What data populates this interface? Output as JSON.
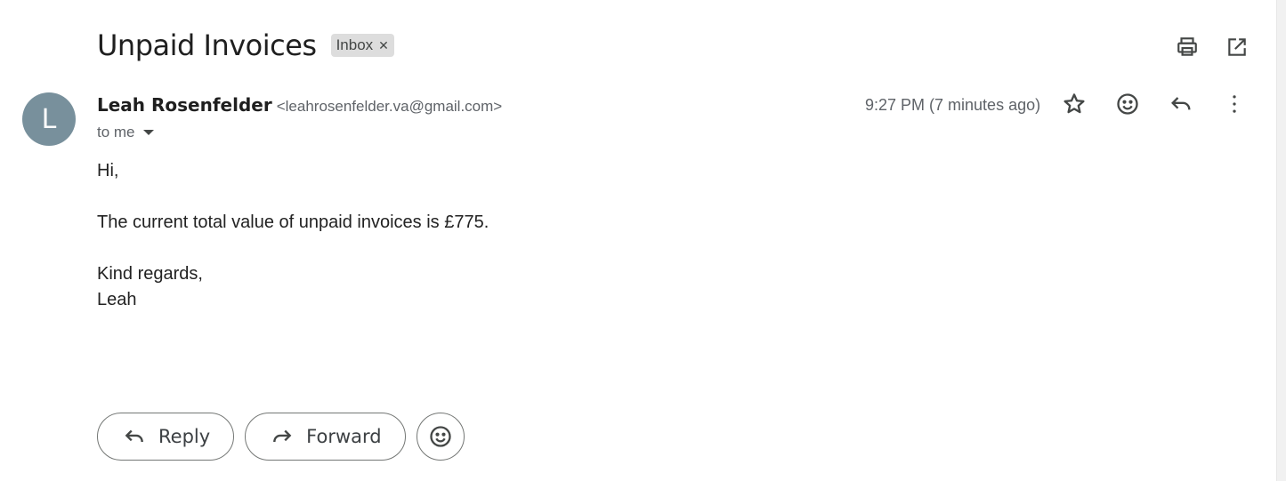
{
  "email": {
    "subject": "Unpaid Invoices",
    "label": "Inbox",
    "sender_name": "Leah Rosenfelder",
    "sender_email": "<leahrosenfelder.va@gmail.com>",
    "avatar_letter": "L",
    "recipient": "to me",
    "time": "9:27 PM (7 minutes ago)",
    "body": {
      "greeting": "Hi,",
      "line1": "The current total value of unpaid invoices is £775.",
      "closing": "Kind regards,",
      "signature": "Leah"
    }
  },
  "actions": {
    "reply_label": "Reply",
    "forward_label": "Forward"
  },
  "icons": [
    "print-icon",
    "open-in-new-window-icon",
    "star-icon",
    "emoji-icon",
    "reply-icon",
    "more-vert-icon",
    "forward-icon"
  ],
  "colors": {
    "avatar": "#78909c",
    "chip_bg": "#dddddd"
  }
}
